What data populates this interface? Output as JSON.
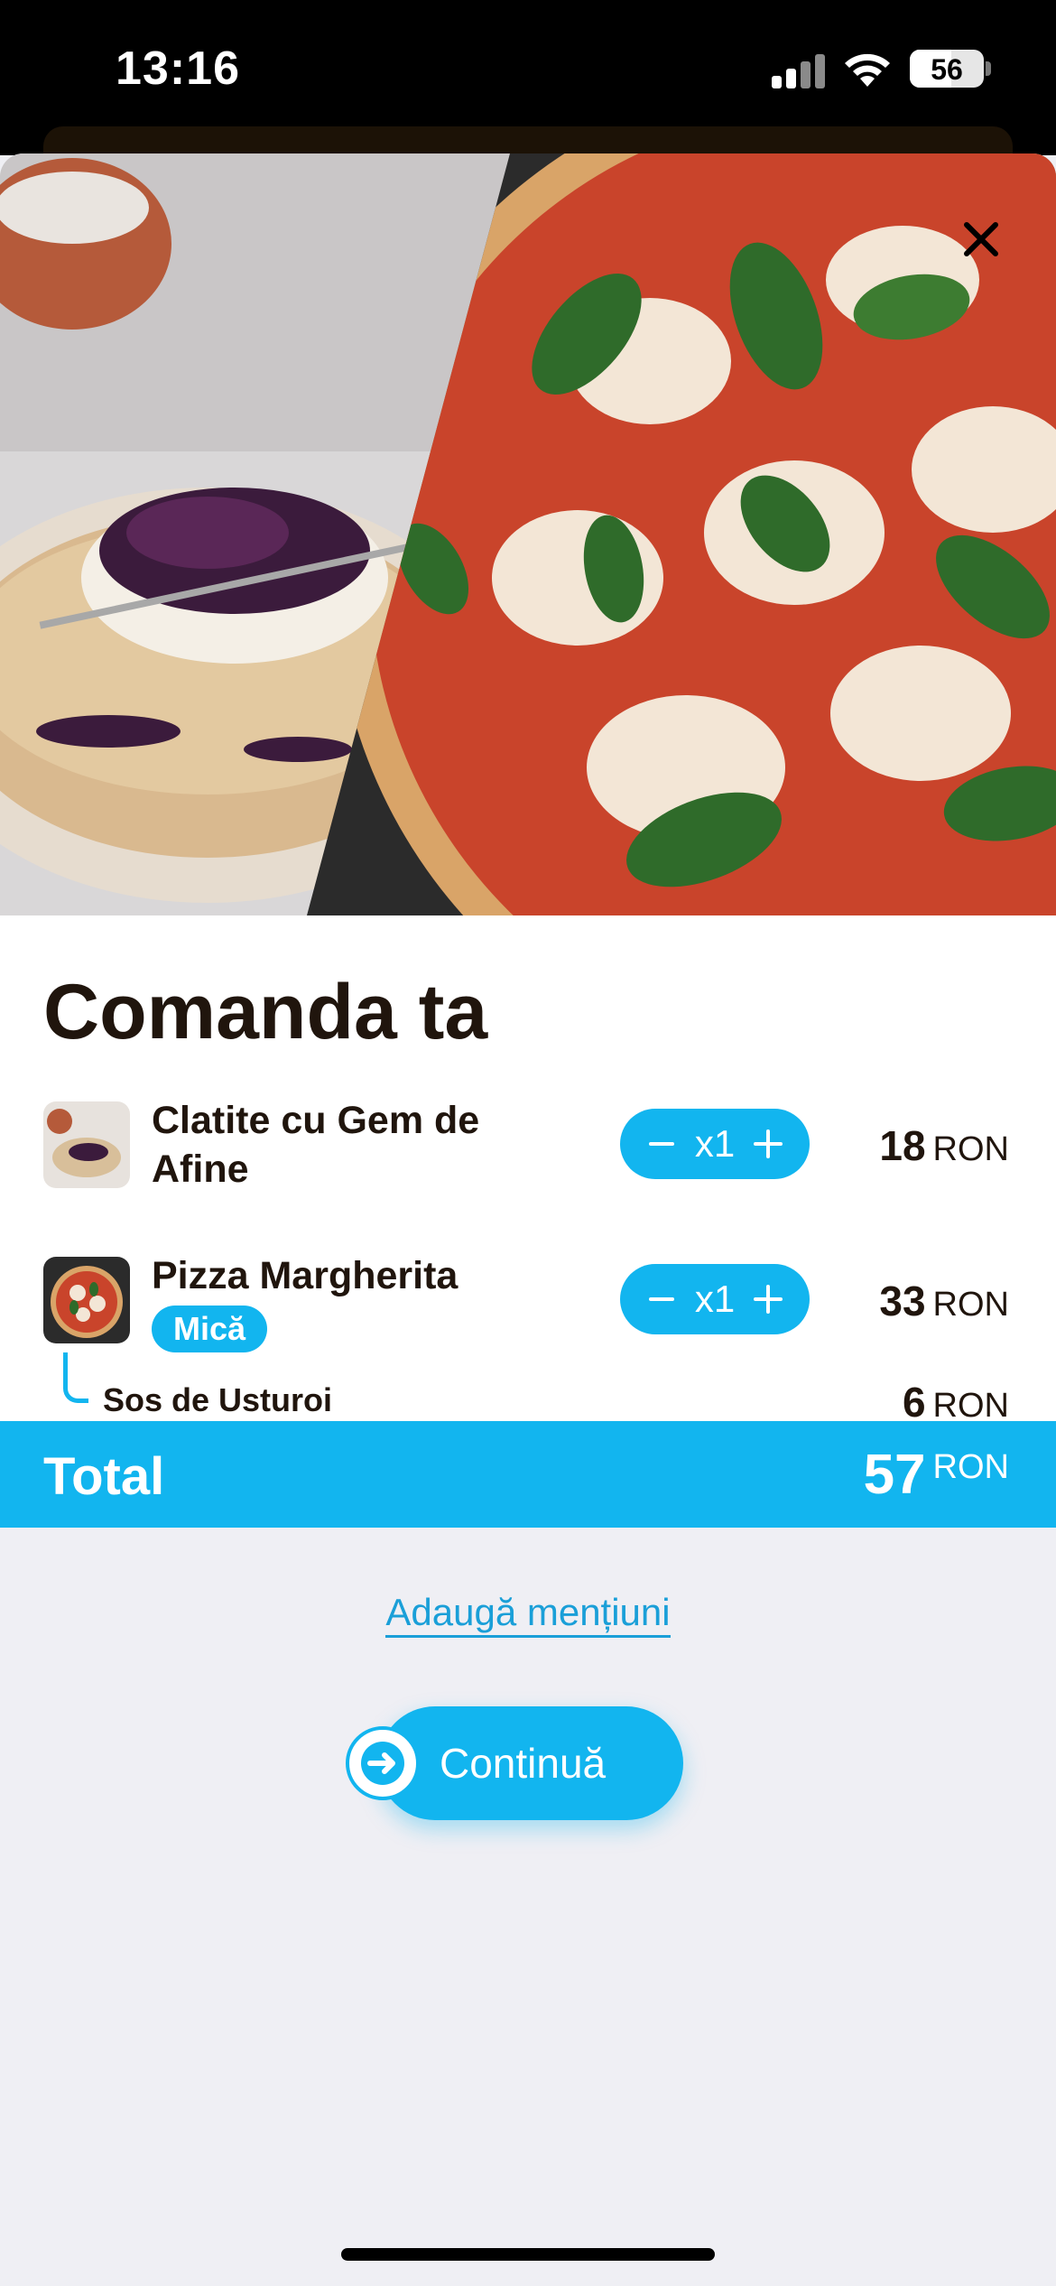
{
  "status_bar": {
    "time": "13:16",
    "battery_level": "56",
    "icons": [
      "signal-icon",
      "wifi-icon",
      "battery-icon"
    ]
  },
  "hero": {
    "image": "clatite-and-pizza-photo",
    "close_icon": "close-icon"
  },
  "order": {
    "title": "Comanda ta",
    "items": [
      {
        "name_line1": "Clatite cu Gem de",
        "name_line2": "Afine",
        "quantity": "x1",
        "price": "18",
        "currency": "RON"
      },
      {
        "name_line1": "Pizza Margherita",
        "size": "Mică",
        "quantity": "x1",
        "price": "33",
        "currency": "RON",
        "extras": [
          {
            "name": "Sos de Usturoi",
            "price": "6",
            "currency": "RON"
          }
        ]
      }
    ],
    "total_label": "Total",
    "total_price": "57",
    "total_currency": "RON"
  },
  "actions": {
    "add_mentions": "Adaugă mențiuni",
    "continue": "Continuă"
  },
  "colors": {
    "accent": "#12b5ef",
    "text_dark": "#20150d",
    "background": "#efeff4"
  }
}
